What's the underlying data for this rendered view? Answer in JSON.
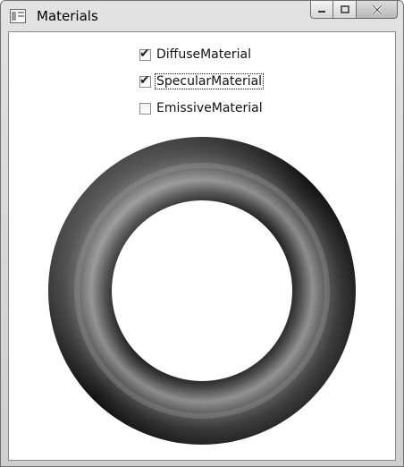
{
  "window": {
    "title": "Materials",
    "controls": {
      "minimize": "minimize",
      "maximize": "maximize",
      "close": "close"
    }
  },
  "checkboxes": [
    {
      "label": "DiffuseMaterial",
      "checked": true,
      "focused": false
    },
    {
      "label": "SpecularMaterial",
      "checked": true,
      "focused": true
    },
    {
      "label": "EmissiveMaterial",
      "checked": false,
      "focused": false
    }
  ],
  "viewport": {
    "object": "torus",
    "color": "#3a3a3a"
  }
}
